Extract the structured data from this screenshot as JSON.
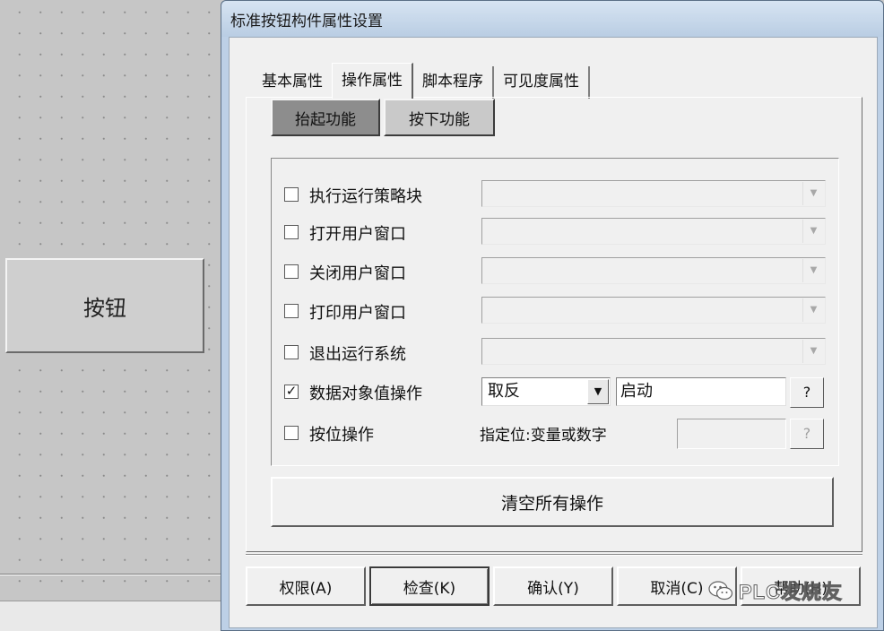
{
  "canvas": {
    "button_label": "按钮"
  },
  "dialog": {
    "title": "标准按钮构件属性设置",
    "tabs": [
      {
        "label": "基本属性",
        "active": false
      },
      {
        "label": "操作属性",
        "active": true
      },
      {
        "label": "脚本程序",
        "active": false
      },
      {
        "label": "可见度属性",
        "active": false
      }
    ],
    "subtabs": {
      "raise": "抬起功能",
      "press": "按下功能"
    },
    "rows": [
      {
        "label": "执行运行策略块",
        "checked": false,
        "check_mark": ""
      },
      {
        "label": "打开用户窗口",
        "checked": false,
        "check_mark": ""
      },
      {
        "label": "关闭用户窗口",
        "checked": false,
        "check_mark": ""
      },
      {
        "label": "打印用户窗口",
        "checked": false,
        "check_mark": ""
      },
      {
        "label": "退出运行系统",
        "checked": false,
        "check_mark": ""
      },
      {
        "label": "数据对象值操作",
        "checked": true,
        "check_mark": "✓",
        "op_value": "取反",
        "var_value": "启动",
        "help": "?"
      },
      {
        "label": "按位操作",
        "checked": false,
        "check_mark": "",
        "hint": "指定位:变量或数字",
        "help": "?"
      }
    ],
    "clear_label": "清空所有操作",
    "buttons": {
      "permission": "权限(A)",
      "check": "检查(K)",
      "confirm": "确认(Y)",
      "cancel": "取消(C)",
      "help": "帮助(H)"
    }
  },
  "watermark": {
    "text": "PLC发烧友"
  }
}
